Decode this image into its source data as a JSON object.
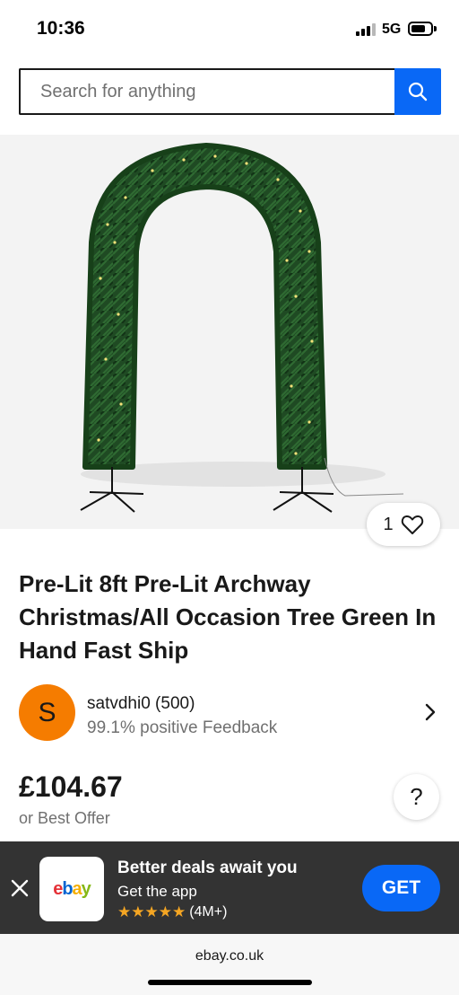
{
  "status_bar": {
    "time": "10:36",
    "network": "5G",
    "signal_bars_active": 3,
    "signal_bars_total": 4
  },
  "search": {
    "placeholder": "Search for anything",
    "button_icon": "search-icon",
    "accent_color": "#0968f6"
  },
  "product": {
    "image_description_icon": "archway-tree-image",
    "watch_count": "1",
    "watch_icon": "heart-icon",
    "title": "Pre-Lit 8ft Pre-Lit Archway Christmas/All Occasion Tree Green In Hand Fast Ship"
  },
  "seller": {
    "avatar_initial": "S",
    "avatar_color": "#f57c00",
    "name": "satvdhi0 (500)",
    "feedback": "99.1% positive Feedback"
  },
  "price": {
    "amount": "£104.67",
    "best_offer": "or Best Offer",
    "help_label": "?"
  },
  "app_banner": {
    "logo_letters": [
      "e",
      "b",
      "a",
      "y"
    ],
    "headline": "Better deals await you",
    "subtext": "Get the app",
    "stars": "★★★★★",
    "rating_count": "(4M+)",
    "get_label": "GET"
  },
  "browser": {
    "url": "ebay.co.uk"
  }
}
